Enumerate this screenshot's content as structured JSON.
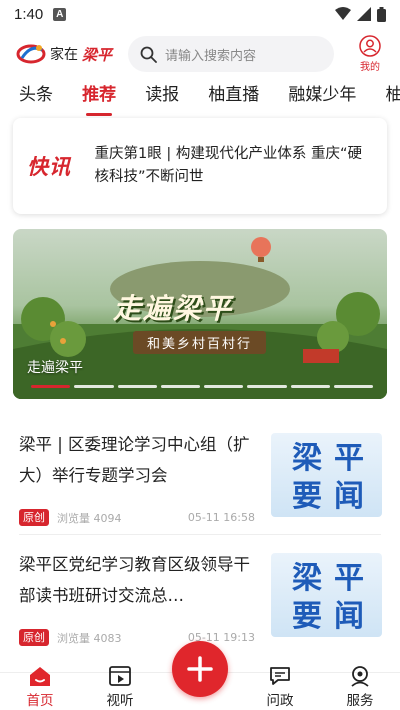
{
  "status_bar": {
    "time": "1:40",
    "notification_glyph": "A"
  },
  "header": {
    "logo_prefix": "家在",
    "logo_brand": "梁平",
    "search_placeholder": "请输入搜索内容",
    "mine_label": "我的"
  },
  "tabs": [
    {
      "label": "头条"
    },
    {
      "label": "推荐",
      "active": true
    },
    {
      "label": "读报"
    },
    {
      "label": "柚直播"
    },
    {
      "label": "融媒少年"
    },
    {
      "label": "柚视"
    }
  ],
  "flash_news": {
    "badge": "快讯",
    "text": "重庆第1眼 | 构建现代化产业体系 重庆“硬核科技”不断问世"
  },
  "banner": {
    "title": "走遍梁平",
    "subtitle": "和美乡村百村行",
    "caption": "走遍梁平",
    "dot_count": 8,
    "active_dot": 0
  },
  "news": [
    {
      "title": "梁平 | 区委理论学习中心组（扩大）举行专题学习会",
      "tag": "原创",
      "views": "浏览量 4094",
      "time": "05-11 16:58",
      "thumb_chars": [
        "梁",
        "平",
        "要",
        "闻"
      ]
    },
    {
      "title": "梁平区党纪学习教育区级领导干部读书班研讨交流总…",
      "tag": "原创",
      "views": "浏览量 4083",
      "time": "05-11 19:13",
      "thumb_chars": [
        "梁",
        "平",
        "要",
        "闻"
      ]
    }
  ],
  "bottom_nav": {
    "home": "首页",
    "video": "视听",
    "ask": "问政",
    "service": "服务"
  },
  "colors": {
    "accent": "#d7262e",
    "thumb_text": "#1e5bb8"
  }
}
